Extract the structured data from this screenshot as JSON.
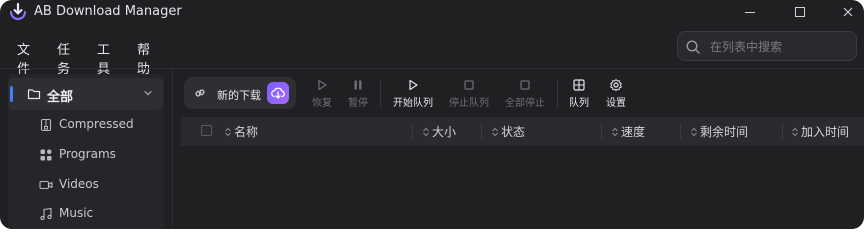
{
  "window": {
    "title": "AB Download Manager",
    "accent_color": "#3b82f6",
    "brand_color": "#7c5cff"
  },
  "menu": [
    "文件",
    "任务",
    "工具",
    "帮助"
  ],
  "search": {
    "placeholder": "在列表中搜索",
    "value": ""
  },
  "sidebar": {
    "all_label": "全部",
    "items": [
      {
        "label": "Compressed",
        "icon": "archive-icon"
      },
      {
        "label": "Programs",
        "icon": "programs-icon"
      },
      {
        "label": "Videos",
        "icon": "video-icon"
      },
      {
        "label": "Music",
        "icon": "music-icon"
      }
    ]
  },
  "toolbar": {
    "new_download": "新的下载",
    "resume": "恢复",
    "pause": "暂停",
    "start_queue": "开始队列",
    "stop_queue": "停止队列",
    "stop_all": "全部停止",
    "queue": "队列",
    "settings": "设置"
  },
  "table": {
    "columns": [
      "名称",
      "大小",
      "状态",
      "速度",
      "剩余时间",
      "加入时间"
    ]
  }
}
